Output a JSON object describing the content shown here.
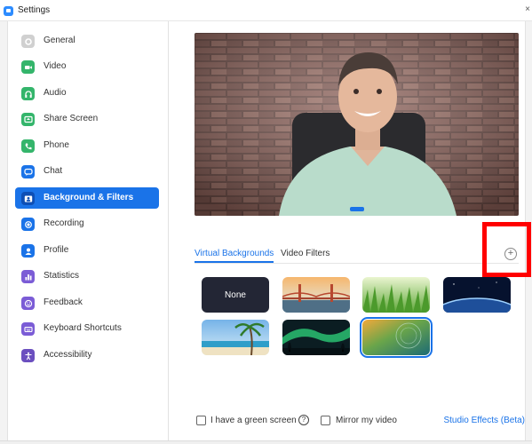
{
  "window": {
    "title": "Settings",
    "close_glyph": "×"
  },
  "sidebar": {
    "items": [
      {
        "label": "General",
        "icon": "gear-icon",
        "color": "#d0d0d0"
      },
      {
        "label": "Video",
        "icon": "video-camera-icon",
        "color": "#34b56b"
      },
      {
        "label": "Audio",
        "icon": "headphones-icon",
        "color": "#34b56b"
      },
      {
        "label": "Share Screen",
        "icon": "share-screen-icon",
        "color": "#34b56b"
      },
      {
        "label": "Phone",
        "icon": "phone-icon",
        "color": "#34b56b"
      },
      {
        "label": "Chat",
        "icon": "chat-bubble-icon",
        "color": "#1a73e8"
      },
      {
        "label": "Background & Filters",
        "icon": "background-person-icon",
        "color": "#1a73e8",
        "active": true
      },
      {
        "label": "Recording",
        "icon": "record-icon",
        "color": "#1a73e8"
      },
      {
        "label": "Profile",
        "icon": "profile-icon",
        "color": "#1a73e8"
      },
      {
        "label": "Statistics",
        "icon": "bar-chart-icon",
        "color": "#7b5cd6"
      },
      {
        "label": "Feedback",
        "icon": "smiley-icon",
        "color": "#7b5cd6"
      },
      {
        "label": "Keyboard Shortcuts",
        "icon": "keyboard-icon",
        "color": "#7b5cd6"
      },
      {
        "label": "Accessibility",
        "icon": "accessibility-icon",
        "color": "#6b4fbf"
      }
    ]
  },
  "tabs": {
    "virtual_backgrounds": "Virtual Backgrounds",
    "video_filters": "Video Filters",
    "active": "virtual_backgrounds"
  },
  "add_button_glyph": "+",
  "backgrounds": [
    {
      "label": "None",
      "kind": "none"
    },
    {
      "kind": "golden-gate-bridge"
    },
    {
      "kind": "grass"
    },
    {
      "kind": "earth-from-space"
    },
    {
      "kind": "beach-palm"
    },
    {
      "kind": "aurora"
    },
    {
      "kind": "abstract-gradient",
      "selected": true
    }
  ],
  "footer": {
    "green_screen": "I have a green screen",
    "help_glyph": "?",
    "mirror_video": "Mirror my video",
    "studio_effects": "Studio Effects (Beta)"
  },
  "colors": {
    "accent": "#1a73e8",
    "highlight": "#ff0000"
  }
}
